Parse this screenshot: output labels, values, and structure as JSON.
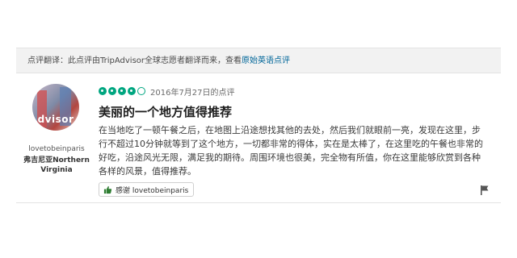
{
  "translation_bar": {
    "prefix": "点评翻译：",
    "message": "此点评由TripAdvisor全球志愿者翻译而来，查看",
    "link": "原始英语点评"
  },
  "reviewer": {
    "avatar_brand": "dvisor",
    "username": "lovetobeinparis",
    "location": "弗吉尼亚Northern Virginia"
  },
  "review": {
    "rating": 4,
    "rating_max": 5,
    "date": "2016年7月27日的点评",
    "title": "美丽的一个地方值得推荐",
    "body": "在当地吃了一顿午餐之后，在地图上沿途想找其他的去处，然后我们就眼前一亮，发现在这里，步行不超过10分钟就等到了这个地方，一切都非常的得体，实在是太棒了，在这里吃的午餐也非常的好吃，沿途风光无限，满足我的期待。周围环境也很美，完全物有所值，你在这里能够欣赏到各种各样的风景，值得推荐。"
  },
  "actions": {
    "thanks_label": "感谢 lovetobeinparis"
  },
  "icons": {
    "thumbs_up": "thumbs-up-icon",
    "flag": "flag-icon"
  },
  "colors": {
    "rating_green": "#00a680",
    "link_blue": "#006699",
    "thumb_green": "#2e7d32"
  }
}
